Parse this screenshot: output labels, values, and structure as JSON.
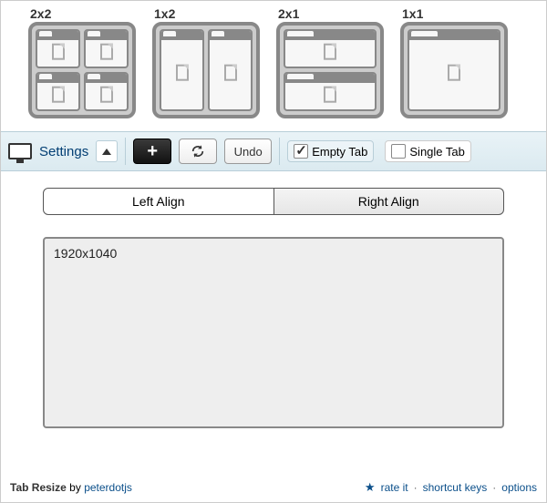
{
  "layouts": [
    {
      "label": "2x2",
      "cls": "t2x2",
      "panes": 4
    },
    {
      "label": "1x2",
      "cls": "t1x2",
      "panes": 2
    },
    {
      "label": "2x1",
      "cls": "t2x1",
      "panes": 2
    },
    {
      "label": "1x1",
      "cls": "t1x1",
      "panes": 1
    }
  ],
  "toolbar": {
    "settings_label": "Settings",
    "add_label": "+",
    "undo_label": "Undo",
    "empty_tab_label": "Empty Tab",
    "empty_tab_checked": true,
    "single_tab_label": "Single Tab",
    "single_tab_checked": false
  },
  "align": {
    "left_label": "Left Align",
    "right_label": "Right Align",
    "active": "right"
  },
  "preview": {
    "resolution": "1920x1040"
  },
  "footer": {
    "name": "Tab Resize",
    "by": "by",
    "author": "peterdotjs",
    "rate": "rate it",
    "shortcut": "shortcut keys",
    "options": "options"
  }
}
